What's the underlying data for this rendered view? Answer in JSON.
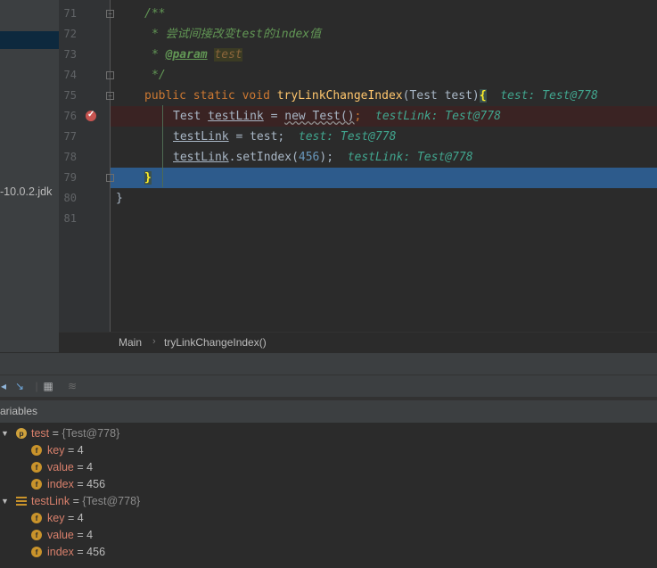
{
  "project": {
    "jdk_label": "-10.0.2.jdk"
  },
  "editor": {
    "line_numbers": [
      "71",
      "72",
      "73",
      "74",
      "75",
      "76",
      "77",
      "78",
      "79",
      "80",
      "81"
    ],
    "code": {
      "l71": "/**",
      "l72": "* 尝试间接改变test的index值",
      "l73_tag": "@param",
      "l73_param": "test",
      "l74": "*/",
      "l75_kw1": "public",
      "l75_kw2": "static",
      "l75_kw3": "void",
      "l75_fn": "tryLinkChangeIndex",
      "l75_args": "(Test test)",
      "l75_brace": "{",
      "l75_inline": "test: Test@778",
      "l76_type": "Test ",
      "l76_var": "testLink",
      "l76_eq": " = ",
      "l76_new": "new Test()",
      "l76_semi": ";",
      "l76_inline": "testLink: Test@778",
      "l77_var": "testLink",
      "l77_rest": " = test;",
      "l77_inline": "test: Test@778",
      "l78_var": "testLink",
      "l78_call": ".setIndex(",
      "l78_num": "456",
      "l78_end": ");",
      "l78_inline": "testLink: Test@778",
      "l79": "}",
      "l80": "}"
    }
  },
  "breadcrumb": {
    "class_name": "Main",
    "method_name": "tryLinkChangeIndex()"
  },
  "debug": {
    "panel_title": "ariables",
    "variables": {
      "test": {
        "name": "test",
        "value": "{Test@778}",
        "badge": "p",
        "fields": [
          {
            "name": "key",
            "value": "4"
          },
          {
            "name": "value",
            "value": "4"
          },
          {
            "name": "index",
            "value": "456"
          }
        ]
      },
      "testLink": {
        "name": "testLink",
        "value": "{Test@778}",
        "fields": [
          {
            "name": "key",
            "value": "4"
          },
          {
            "name": "value",
            "value": "4"
          },
          {
            "name": "index",
            "value": "456"
          }
        ]
      }
    },
    "field_badge": "f",
    "eq": "="
  }
}
